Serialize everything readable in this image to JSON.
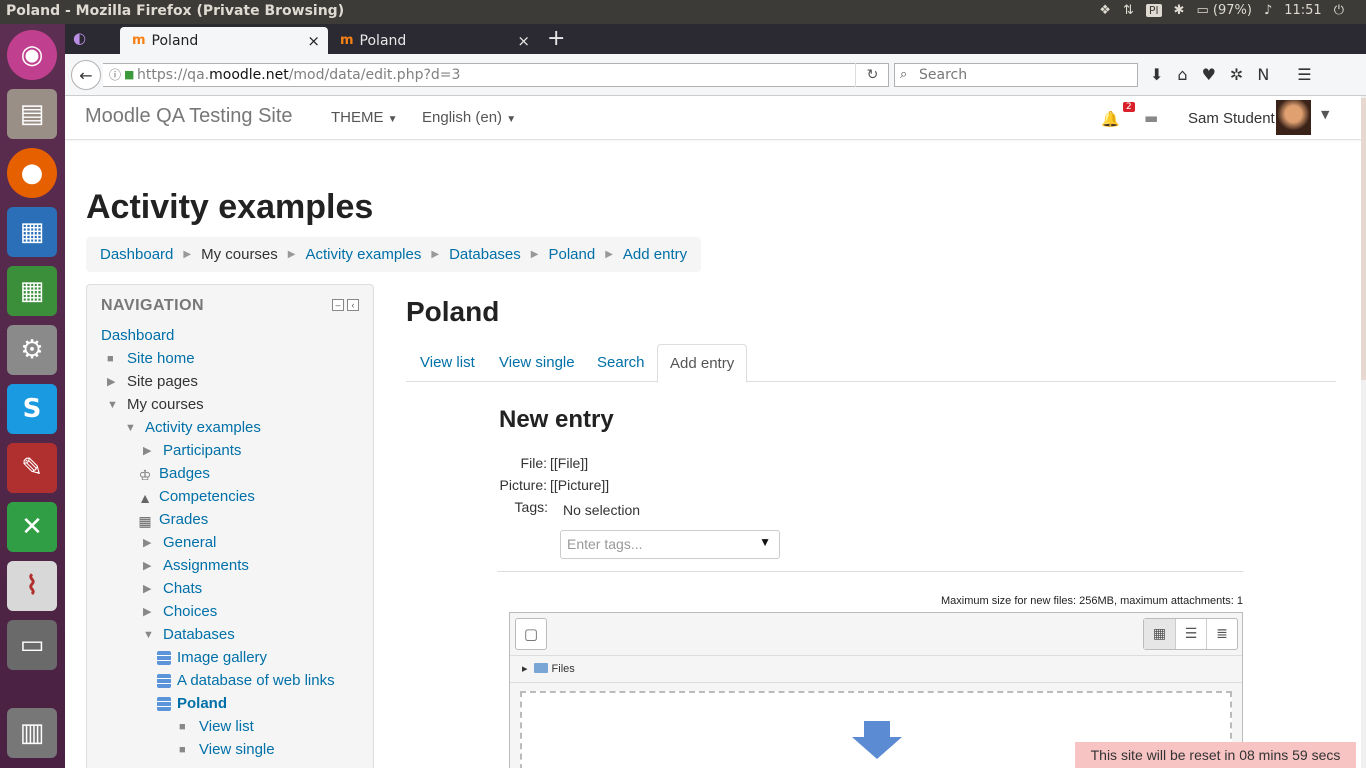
{
  "os": {
    "window_title": "Poland - Mozilla Firefox (Private Browsing)",
    "keyboard": "Pl",
    "battery": "(97%)",
    "clock": "11:51"
  },
  "browser": {
    "tabs": [
      {
        "label": "Poland",
        "favicon": "m"
      },
      {
        "label": "Poland",
        "favicon": "m"
      }
    ],
    "url_prefix": "https://qa.",
    "url_host": "moodle.net",
    "url_path": "/mod/data/edit.php?d=3",
    "search_placeholder": "Search"
  },
  "moodle": {
    "site_name": "Moodle QA Testing Site",
    "menu": {
      "theme": "THEME",
      "language": "English (en)"
    },
    "notifications_count": "2",
    "user_name": "Sam Student",
    "page_title": "Activity examples",
    "breadcrumb": [
      "Dashboard",
      "My courses",
      "Activity examples",
      "Databases",
      "Poland",
      "Add entry"
    ]
  },
  "navigation": {
    "heading": "NAVIGATION",
    "items": [
      {
        "label": "Dashboard"
      },
      {
        "label": "Site home"
      },
      {
        "label": "Site pages"
      },
      {
        "label": "My courses"
      },
      {
        "label": "Activity examples"
      },
      {
        "label": "Participants"
      },
      {
        "label": "Badges"
      },
      {
        "label": "Competencies"
      },
      {
        "label": "Grades"
      },
      {
        "label": "General"
      },
      {
        "label": "Assignments"
      },
      {
        "label": "Chats"
      },
      {
        "label": "Choices"
      },
      {
        "label": "Databases"
      },
      {
        "label": "Image gallery"
      },
      {
        "label": "A database of web links"
      },
      {
        "label": "Poland"
      },
      {
        "label": "View list"
      },
      {
        "label": "View single"
      }
    ]
  },
  "main": {
    "title": "Poland",
    "tabs": [
      "View list",
      "View single",
      "Search",
      "Add entry"
    ],
    "form_title": "New entry",
    "fields": {
      "file_label": "File:",
      "file_value": "[[File]]",
      "picture_label": "Picture:",
      "picture_value": "[[Picture]]",
      "tags_label": "Tags:",
      "tags_value": "No selection",
      "tags_placeholder": "Enter tags..."
    },
    "filepicker": {
      "max_size": "Maximum size for new files: 256MB, maximum attachments: 1",
      "folder": "Files"
    }
  },
  "reset_notice": "This site will be reset in 08 mins 59 secs"
}
